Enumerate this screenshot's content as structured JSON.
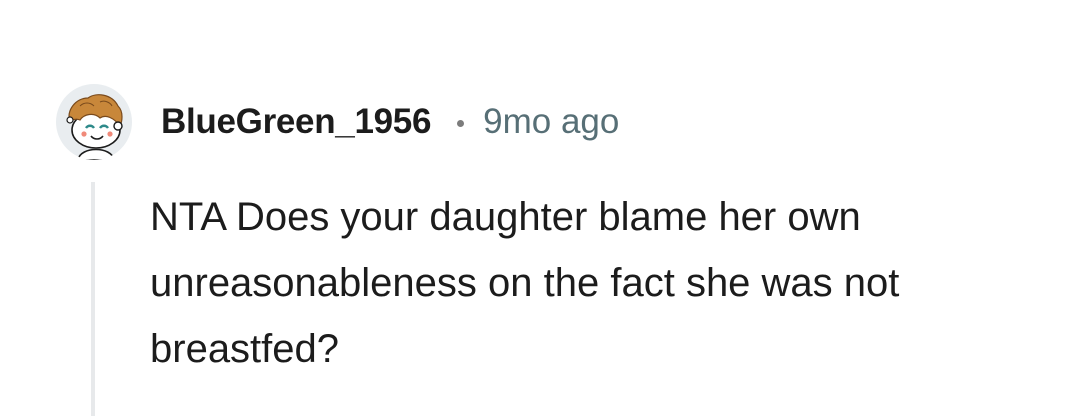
{
  "comment": {
    "author": "BlueGreen_1956",
    "timestamp": "9mo ago",
    "body": "NTA Does your daughter blame her own unreasonableness on the fact she was not breastfed?",
    "avatar_icon": "snoo-avatar-icon"
  },
  "colors": {
    "background": "#ffffff",
    "text": "#1c1c1c",
    "meta_text": "#576f76",
    "thread_line": "#e7e9eb",
    "avatar_bg": "#e9edf0",
    "avatar_hair": "#c8873a"
  }
}
